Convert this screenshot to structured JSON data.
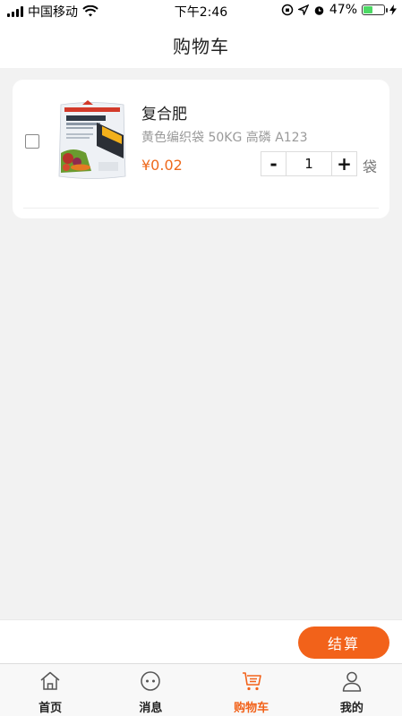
{
  "status_bar": {
    "carrier": "中国移动",
    "time": "下午2:46",
    "battery_percent": "47%",
    "battery_level": 0.47,
    "battery_color": "#4cd964"
  },
  "nav": {
    "title": "购物车"
  },
  "cart": {
    "items": [
      {
        "name": "复合肥",
        "spec": "黄色编织袋 50KG 高磷 A123",
        "price": "¥0.02",
        "quantity": "1",
        "unit": "袋",
        "checked": false,
        "image_icon": "fertilizer-bag-image"
      }
    ],
    "stepper_minus": "-",
    "stepper_plus": "+"
  },
  "checkout": {
    "button_label": "结算"
  },
  "tab_bar": {
    "tabs": [
      {
        "label": "首页",
        "icon": "home-icon",
        "active": false
      },
      {
        "label": "消息",
        "icon": "message-icon",
        "active": false
      },
      {
        "label": "购物车",
        "icon": "cart-icon",
        "active": true
      },
      {
        "label": "我的",
        "icon": "user-icon",
        "active": false
      }
    ]
  },
  "colors": {
    "accent": "#f2621a",
    "price": "#ee6a1d",
    "background": "#f2f2f2"
  }
}
